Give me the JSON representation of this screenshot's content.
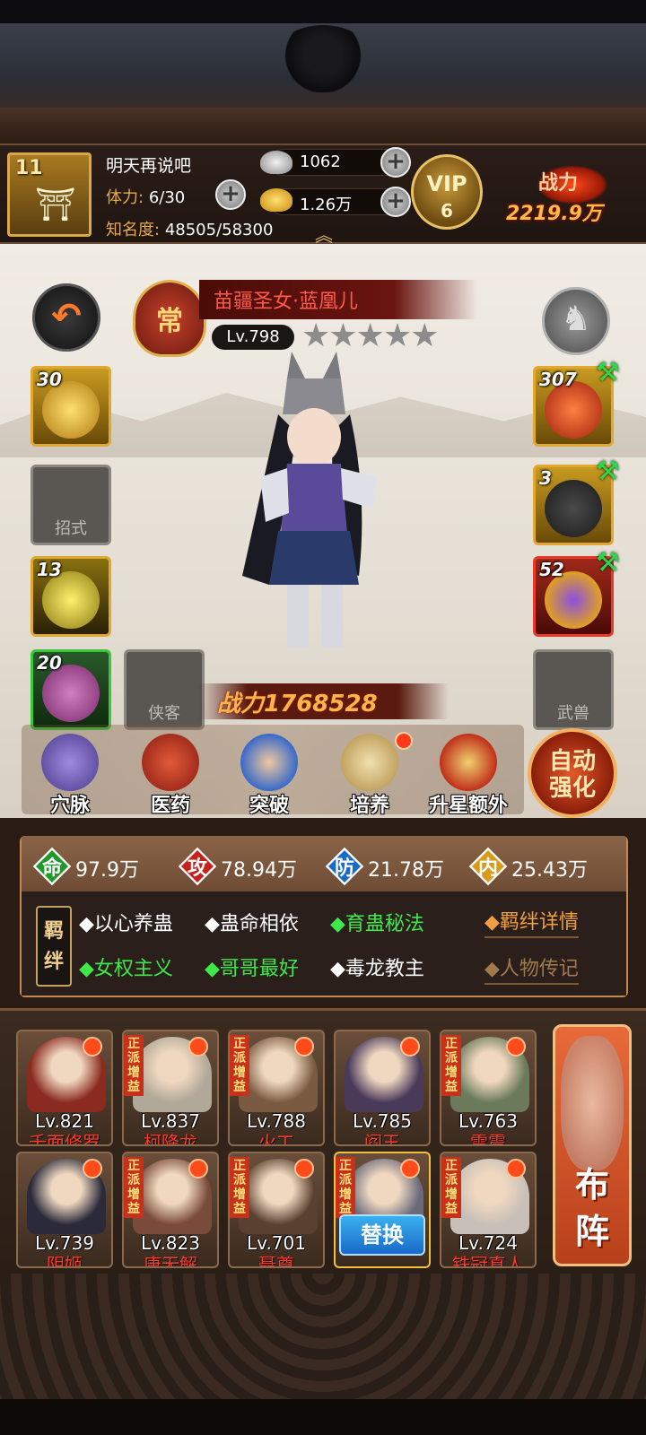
{
  "header": {
    "player_level": "11",
    "player_name": "明天再说吧",
    "stamina_label": "体力:",
    "stamina_value": "6/30",
    "fame_label": "知名度:",
    "fame_value": "48505/58300",
    "silver": "1062",
    "gold": "1.26万",
    "vip_label": "VIP",
    "vip_level": "6",
    "battle_label": "战力",
    "battle_value": "2219.9万"
  },
  "hero": {
    "sect_badge": "常",
    "name": "苗疆圣女·蓝凰儿",
    "level": "Lv.798",
    "stars": "★★★★★",
    "power_label": "战力",
    "power_value": "1768528"
  },
  "left_slots": [
    {
      "count": "30"
    },
    {
      "label": "招式"
    },
    {
      "count": "13"
    },
    {
      "count": "20"
    },
    {
      "label": "侠客"
    }
  ],
  "right_slots": [
    {
      "count": "307"
    },
    {
      "count": "3"
    },
    {
      "count": "52"
    },
    {
      "label": "武兽"
    }
  ],
  "functions": [
    {
      "label": "穴脉"
    },
    {
      "label": "医药"
    },
    {
      "label": "突破"
    },
    {
      "label": "培养"
    },
    {
      "label": "升星额外"
    }
  ],
  "auto_strengthen": {
    "line1": "自动",
    "line2": "强化"
  },
  "stats": [
    {
      "char": "命",
      "value": "97.9万",
      "color": "#1f9a2a"
    },
    {
      "char": "攻",
      "value": "78.94万",
      "color": "#c8201a"
    },
    {
      "char": "防",
      "value": "21.78万",
      "color": "#1a6ac8"
    },
    {
      "char": "内",
      "value": "25.43万",
      "color": "#d89a1a"
    }
  ],
  "bonds": {
    "seal_line1": "羁",
    "seal_line2": "绊",
    "items": [
      {
        "text": "◆以心养蛊",
        "active": false
      },
      {
        "text": "◆蛊命相依",
        "active": false
      },
      {
        "text": "◆育蛊秘法",
        "active": true
      },
      {
        "text": "◆女权主义",
        "active": true
      },
      {
        "text": "◆哥哥最好",
        "active": true
      },
      {
        "text": "◆毒龙教主",
        "active": false
      }
    ],
    "details_link": "◆羁绊详情",
    "bio_link": "◆人物传记"
  },
  "roster": [
    {
      "level": "Lv.821",
      "name": "千面修罗",
      "tag": "",
      "color": "#8a2a20"
    },
    {
      "level": "Lv.837",
      "name": "柯降龙",
      "tag": "正派增益",
      "color": "#b0a898"
    },
    {
      "level": "Lv.788",
      "name": "火工",
      "tag": "正派增益",
      "color": "#7a5a40"
    },
    {
      "level": "Lv.785",
      "name": "阎王",
      "tag": "",
      "color": "#4a3a5a"
    },
    {
      "level": "Lv.763",
      "name": "雷震",
      "tag": "正派增益",
      "color": "#6a7a5a"
    },
    {
      "level": "Lv.739",
      "name": "阴姬",
      "tag": "",
      "color": "#2a2a3a"
    },
    {
      "level": "Lv.823",
      "name": "唐无解",
      "tag": "正派增益",
      "color": "#7a4a3a"
    },
    {
      "level": "Lv.701",
      "name": "聂尊",
      "tag": "正派增益",
      "color": "#5a4030"
    },
    {
      "level": "",
      "name": "",
      "tag": "正派增益",
      "color": "#6a6a7a"
    },
    {
      "level": "Lv.724",
      "name": "铁冠真人",
      "tag": "正派增益",
      "color": "#c8c0b8"
    }
  ],
  "swap_label": "替换",
  "formation": {
    "line1": "布",
    "line2": "阵"
  }
}
